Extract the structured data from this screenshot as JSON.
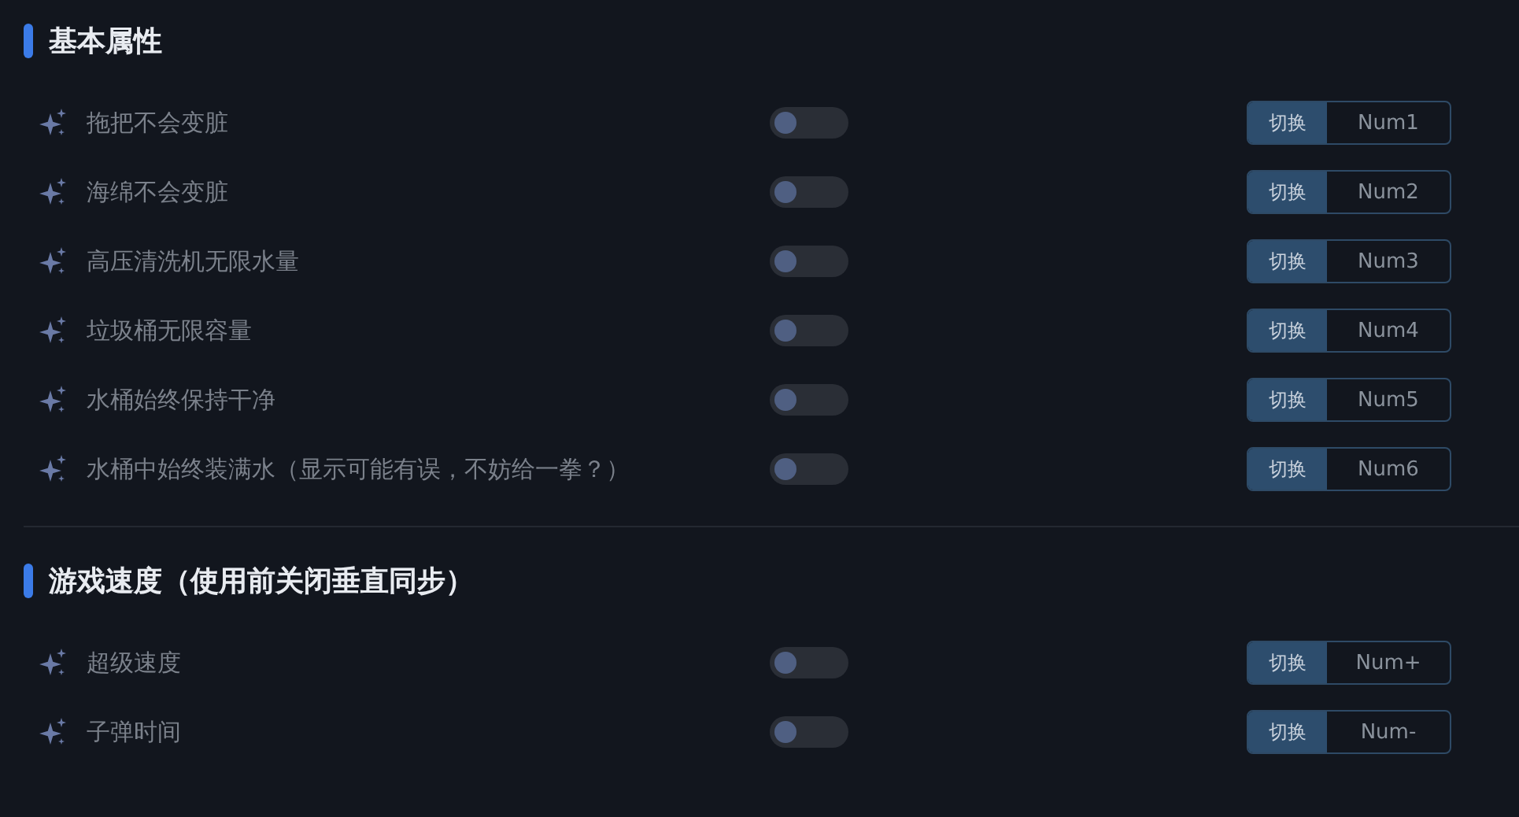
{
  "sections": [
    {
      "title": "基本属性",
      "items": [
        {
          "label": "拖把不会变脏",
          "on": false,
          "action": "切换",
          "key": "Num1"
        },
        {
          "label": "海绵不会变脏",
          "on": false,
          "action": "切换",
          "key": "Num2"
        },
        {
          "label": "高压清洗机无限水量",
          "on": false,
          "action": "切换",
          "key": "Num3"
        },
        {
          "label": "垃圾桶无限容量",
          "on": false,
          "action": "切换",
          "key": "Num4"
        },
        {
          "label": "水桶始终保持干净",
          "on": false,
          "action": "切换",
          "key": "Num5"
        },
        {
          "label": "水桶中始终装满水（显示可能有误，不妨给一拳？）",
          "on": false,
          "action": "切换",
          "key": "Num6"
        }
      ]
    },
    {
      "title": "游戏速度（使用前关闭垂直同步）",
      "items": [
        {
          "label": "超级速度",
          "on": false,
          "action": "切换",
          "key": "Num+"
        },
        {
          "label": "子弹时间",
          "on": false,
          "action": "切换",
          "key": "Num-"
        }
      ]
    }
  ]
}
